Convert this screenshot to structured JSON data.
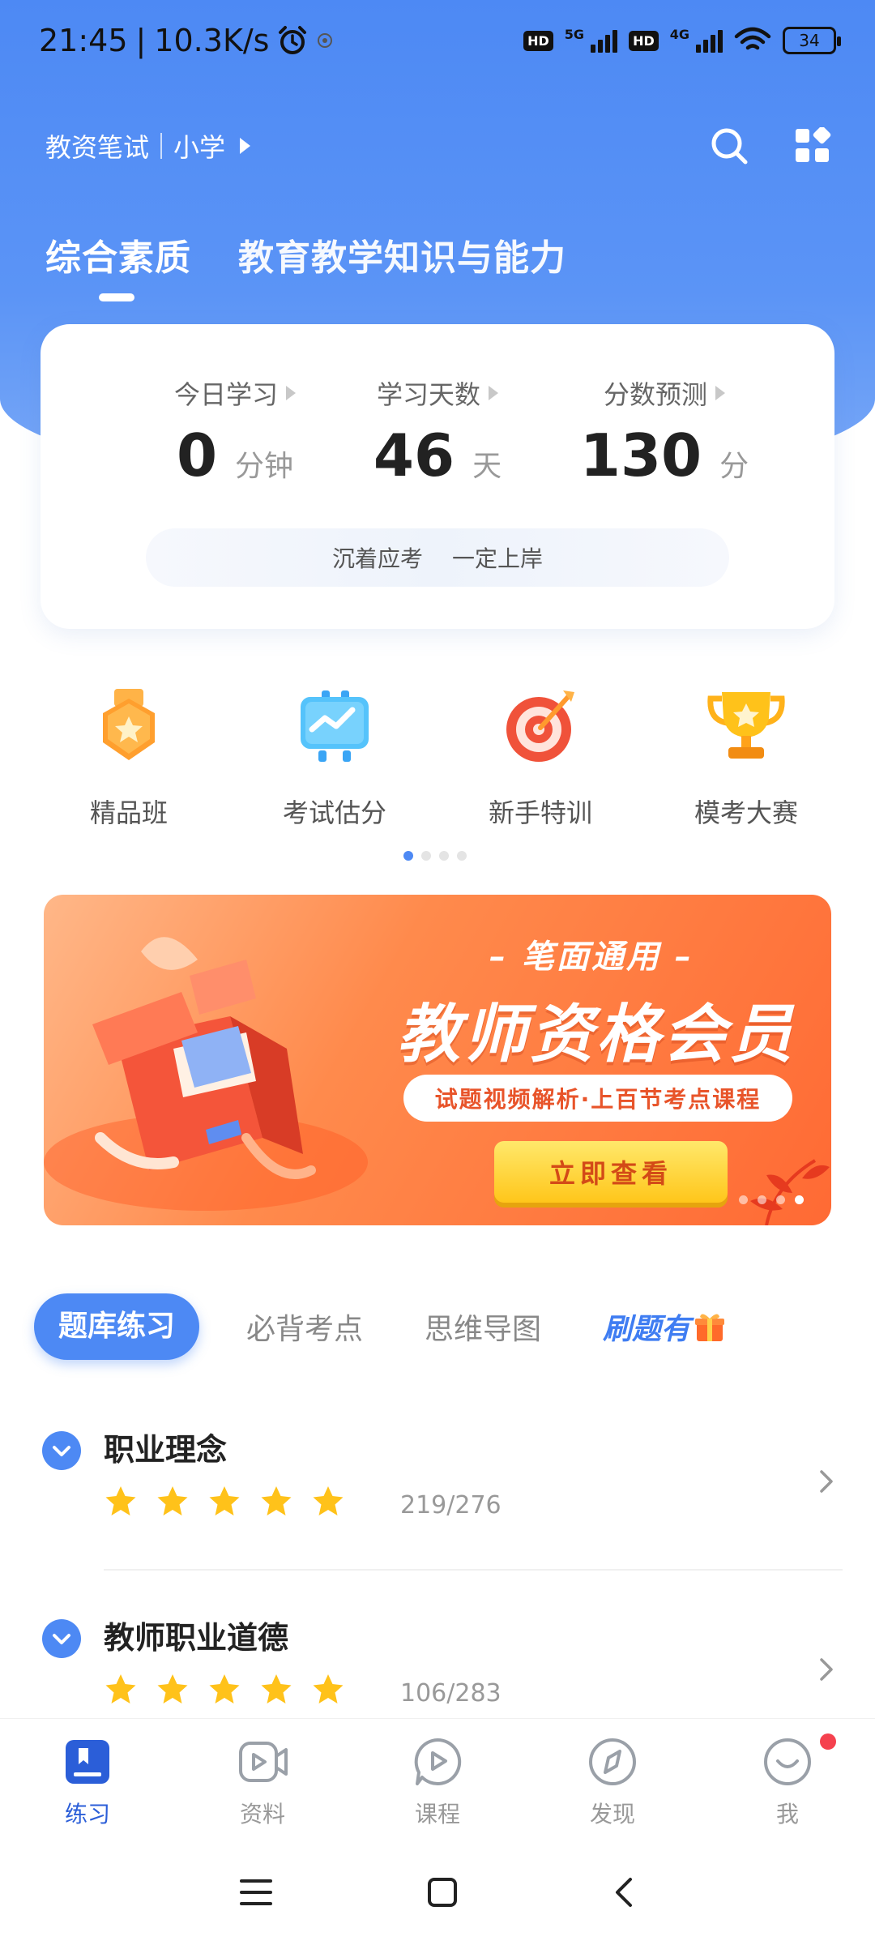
{
  "status_bar": {
    "time": "21:45",
    "speed": "10.3K/s",
    "sim1": "5G",
    "sim2": "4G",
    "hd": "HD",
    "battery": "34"
  },
  "header": {
    "exam": "教资笔试",
    "level": "小学"
  },
  "subject_tabs": [
    {
      "label": "综合素质",
      "active": true
    },
    {
      "label": "教育教学知识与能力",
      "active": false
    }
  ],
  "stats": {
    "items": [
      {
        "label": "今日学习",
        "value": "0",
        "unit": "分钟"
      },
      {
        "label": "学习天数",
        "value": "46",
        "unit": "天"
      },
      {
        "label": "分数预测",
        "value": "130",
        "unit": "分"
      }
    ],
    "motto": [
      "沉着应考",
      "一定上岸"
    ]
  },
  "quick_entries": [
    {
      "label": "精品班",
      "icon": "medal-icon"
    },
    {
      "label": "考试估分",
      "icon": "chart-board-icon"
    },
    {
      "label": "新手特训",
      "icon": "target-icon"
    },
    {
      "label": "模考大赛",
      "icon": "trophy-icon"
    }
  ],
  "quick_page": {
    "current": 1,
    "total": 4
  },
  "banner": {
    "subtitle": "– 笔面通用 –",
    "title": "教师资格会员",
    "tagline": "试题视频解析·上百节考点课程",
    "cta": "立即查看",
    "page": {
      "current": 4,
      "total": 4
    }
  },
  "practice_tabs": [
    {
      "label": "题库练习",
      "active": true
    },
    {
      "label": "必背考点",
      "active": false
    },
    {
      "label": "思维导图",
      "active": false
    },
    {
      "label": "刷题有",
      "active": false,
      "promo": true
    }
  ],
  "chapters": [
    {
      "title": "职业理念",
      "stars": 5,
      "progress": "219/276"
    },
    {
      "title": "教师职业道德",
      "stars": 5,
      "progress": "106/283"
    }
  ],
  "tabbar": [
    {
      "label": "练习",
      "icon": "practice-book-icon",
      "active": true
    },
    {
      "label": "资料",
      "icon": "video-material-icon",
      "active": false
    },
    {
      "label": "课程",
      "icon": "course-play-icon",
      "active": false
    },
    {
      "label": "发现",
      "icon": "compass-icon",
      "active": false
    },
    {
      "label": "我",
      "icon": "profile-face-icon",
      "active": false,
      "badge": true
    }
  ],
  "colors": {
    "primary": "#4d89f4",
    "star": "#ffc21a",
    "banner": "#ff7a3d",
    "badge": "#f5414e"
  }
}
